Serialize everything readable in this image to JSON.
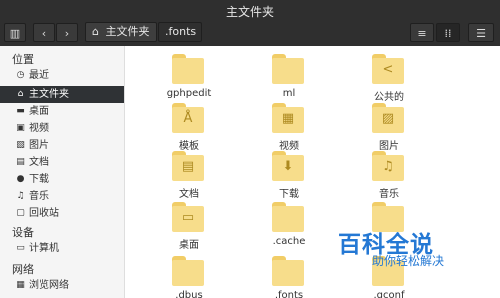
{
  "window": {
    "title": "主文件夹"
  },
  "toolbar": {
    "toggle_sidebar_icon": "sidebar-toggle-icon",
    "back_icon": "back-arrow-icon",
    "forward_icon": "forward-arrow-icon",
    "home_icon": "home-icon",
    "view_list_icon": "list-view-icon",
    "view_grid_icon": "grid-view-icon",
    "menu_icon": "hamburger-icon"
  },
  "breadcrumb": [
    {
      "label": "主文件夹",
      "active": true
    },
    {
      "label": ".fonts",
      "active": false
    }
  ],
  "sidebar": {
    "places_title": "位置",
    "places": [
      {
        "label": "最近",
        "icon": "recent-icon"
      },
      {
        "label": "主文件夹",
        "icon": "home-icon",
        "selected": true
      },
      {
        "label": "桌面",
        "icon": "desktop-icon"
      },
      {
        "label": "视频",
        "icon": "video-icon"
      },
      {
        "label": "图片",
        "icon": "image-icon"
      },
      {
        "label": "文档",
        "icon": "document-icon"
      },
      {
        "label": "下载",
        "icon": "download-icon"
      },
      {
        "label": "音乐",
        "icon": "music-icon"
      },
      {
        "label": "回收站",
        "icon": "trash-icon"
      }
    ],
    "devices_title": "设备",
    "devices": [
      {
        "label": "计算机",
        "icon": "computer-icon"
      }
    ],
    "network_title": "网络",
    "network": [
      {
        "label": "浏览网络",
        "icon": "network-icon"
      }
    ]
  },
  "files": [
    {
      "name": "gphpedit",
      "icon": "folder-icon"
    },
    {
      "name": "ml",
      "icon": "folder-icon"
    },
    {
      "name": "公共的",
      "icon": "folder-share-icon"
    },
    {
      "name": "模板",
      "icon": "folder-templates-icon"
    },
    {
      "name": "视频",
      "icon": "folder-video-icon"
    },
    {
      "name": "图片",
      "icon": "folder-pictures-icon"
    },
    {
      "name": "文档",
      "icon": "folder-documents-icon"
    },
    {
      "name": "下载",
      "icon": "folder-download-icon"
    },
    {
      "name": "音乐",
      "icon": "folder-music-icon"
    },
    {
      "name": "桌面",
      "icon": "folder-desktop-icon"
    },
    {
      "name": ".cache",
      "icon": "folder-icon"
    },
    {
      "name": "",
      "icon": "folder-icon"
    },
    {
      "name": ".dbus",
      "icon": "folder-icon"
    },
    {
      "name": ".fonts",
      "icon": "folder-icon"
    },
    {
      "name": ".gconf",
      "icon": "folder-icon"
    }
  ],
  "watermark": {
    "title": "百科全说",
    "subtitle": "助你轻松解决"
  }
}
